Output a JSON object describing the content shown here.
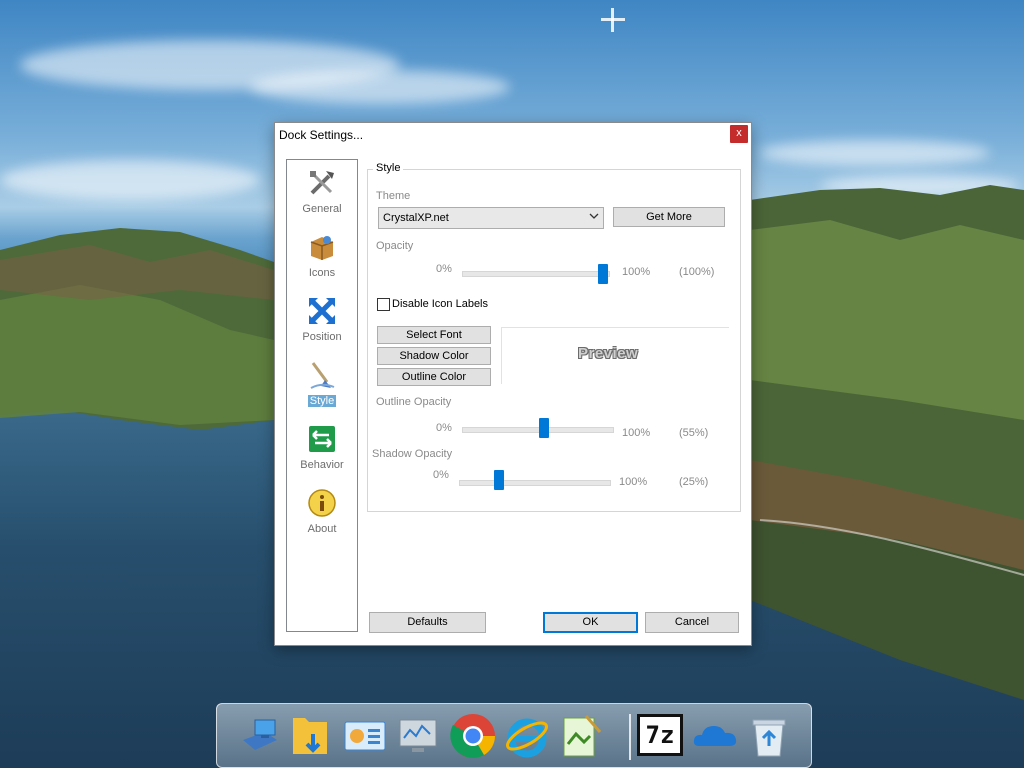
{
  "dialog": {
    "title": "Dock Settings...",
    "close_label": "x"
  },
  "nav": {
    "items": [
      {
        "label": "General",
        "icon": "tools-icon"
      },
      {
        "label": "Icons",
        "icon": "box-icon"
      },
      {
        "label": "Position",
        "icon": "arrows-icon"
      },
      {
        "label": "Style",
        "icon": "brush-icon"
      },
      {
        "label": "Behavior",
        "icon": "behavior-arrow-icon"
      },
      {
        "label": "About",
        "icon": "info-icon"
      }
    ],
    "active": "Style"
  },
  "style": {
    "group_title": "Style",
    "theme_label": "Theme",
    "theme_value": "CrystalXP.net",
    "get_more": "Get More",
    "opacity_label": "Opacity",
    "opacity_min": "0%",
    "opacity_max": "100%",
    "opacity_readout": "(100%)",
    "opacity_value": 100,
    "disable_labels": "Disable Icon Labels",
    "disable_labels_checked": false,
    "select_font": "Select Font",
    "shadow_color": "Shadow Color",
    "outline_color": "Outline Color",
    "preview": "Preview",
    "outline_opacity_label": "Outline Opacity",
    "outline_min": "0%",
    "outline_max": "100%",
    "outline_readout": "(55%)",
    "outline_value": 55,
    "shadow_opacity_label": "Shadow Opacity",
    "shadow_min": "0%",
    "shadow_max": "100%",
    "shadow_readout": "(25%)",
    "shadow_value": 25
  },
  "footer": {
    "defaults": "Defaults",
    "ok": "OK",
    "cancel": "Cancel"
  },
  "dock": {
    "items": [
      "computer-icon",
      "folder-download-icon",
      "control-panel-icon",
      "monitor-icon",
      "chrome-icon",
      "internet-explorer-icon",
      "notepad-icon",
      "7zip-icon",
      "onedrive-icon",
      "recycle-bin-icon"
    ],
    "sevenzip_text": "7z"
  }
}
